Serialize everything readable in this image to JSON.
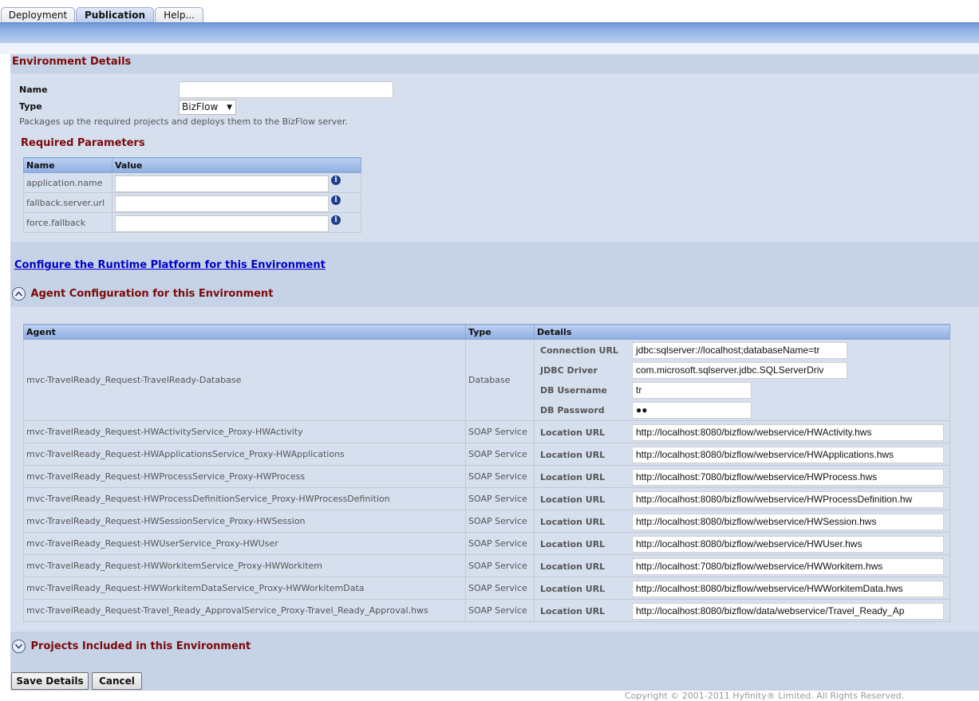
{
  "tabs": [
    {
      "label": "Deployment",
      "active": false
    },
    {
      "label": "Publication",
      "active": true
    },
    {
      "label": "Help...",
      "active": false
    }
  ],
  "environment": {
    "heading": "Environment Details",
    "name_label": "Name",
    "name_value": "",
    "type_label": "Type",
    "type_value": "BizFlow",
    "description": "Packages up the required projects and deploys them to the BizFlow server."
  },
  "required_params": {
    "heading": "Required Parameters",
    "columns": [
      "Name",
      "Value"
    ],
    "rows": [
      {
        "name": "application.name",
        "value": ""
      },
      {
        "name": "fallback.server.url",
        "value": ""
      },
      {
        "name": "force.fallback",
        "value": ""
      }
    ]
  },
  "runtime_link": "Configure the Runtime Platform for this Environment",
  "agent_config": {
    "heading": "Agent Configuration for this Environment",
    "columns": [
      "Agent",
      "Type",
      "Details"
    ],
    "database": {
      "agent": "mvc-TravelReady_Request-TravelReady-Database",
      "type": "Database",
      "fields": [
        {
          "label": "Connection URL",
          "value": "jdbc:sqlserver://localhost;databaseName=tr"
        },
        {
          "label": "JDBC Driver",
          "value": "com.microsoft.sqlserver.jdbc.SQLServerDriv"
        },
        {
          "label": "DB Username",
          "value": "tr"
        },
        {
          "label": "DB Password",
          "value": "●●"
        }
      ]
    },
    "soap_rows": [
      {
        "agent": "mvc-TravelReady_Request-HWActivityService_Proxy-HWActivity",
        "type": "SOAP Service",
        "label": "Location URL",
        "value": "http://localhost:8080/bizflow/webservice/HWActivity.hws"
      },
      {
        "agent": "mvc-TravelReady_Request-HWApplicationsService_Proxy-HWApplications",
        "type": "SOAP Service",
        "label": "Location URL",
        "value": "http://localhost:8080/bizflow/webservice/HWApplications.hws"
      },
      {
        "agent": "mvc-TravelReady_Request-HWProcessService_Proxy-HWProcess",
        "type": "SOAP Service",
        "label": "Location URL",
        "value": "http://localhost:7080/bizflow/webservice/HWProcess.hws"
      },
      {
        "agent": "mvc-TravelReady_Request-HWProcessDefinitionService_Proxy-HWProcessDefinition",
        "type": "SOAP Service",
        "label": "Location URL",
        "value": "http://localhost:8080/bizflow/webservice/HWProcessDefinition.hw"
      },
      {
        "agent": "mvc-TravelReady_Request-HWSessionService_Proxy-HWSession",
        "type": "SOAP Service",
        "label": "Location URL",
        "value": "http://localhost:8080/bizflow/webservice/HWSession.hws"
      },
      {
        "agent": "mvc-TravelReady_Request-HWUserService_Proxy-HWUser",
        "type": "SOAP Service",
        "label": "Location URL",
        "value": "http://localhost:8080/bizflow/webservice/HWUser.hws"
      },
      {
        "agent": "mvc-TravelReady_Request-HWWorkitemService_Proxy-HWWorkitem",
        "type": "SOAP Service",
        "label": "Location URL",
        "value": "http://localhost:7080/bizflow/webservice/HWWorkitem.hws"
      },
      {
        "agent": "mvc-TravelReady_Request-HWWorkitemDataService_Proxy-HWWorkitemData",
        "type": "SOAP Service",
        "label": "Location URL",
        "value": "http://localhost:8080/bizflow/webservice/HWWorkitemData.hws"
      },
      {
        "agent": "mvc-TravelReady_Request-Travel_Ready_ApprovalService_Proxy-Travel_Ready_Approval.hws",
        "type": "SOAP Service",
        "label": "Location URL",
        "value": "http://localhost:8080/bizflow/data/webservice/Travel_Ready_Ap"
      }
    ]
  },
  "projects_heading": "Projects Included in this Environment",
  "buttons": {
    "save": "Save Details",
    "cancel": "Cancel"
  },
  "footer": "Copyright © 2001-2011 Hyfinity® Limited. All Rights Reserved."
}
